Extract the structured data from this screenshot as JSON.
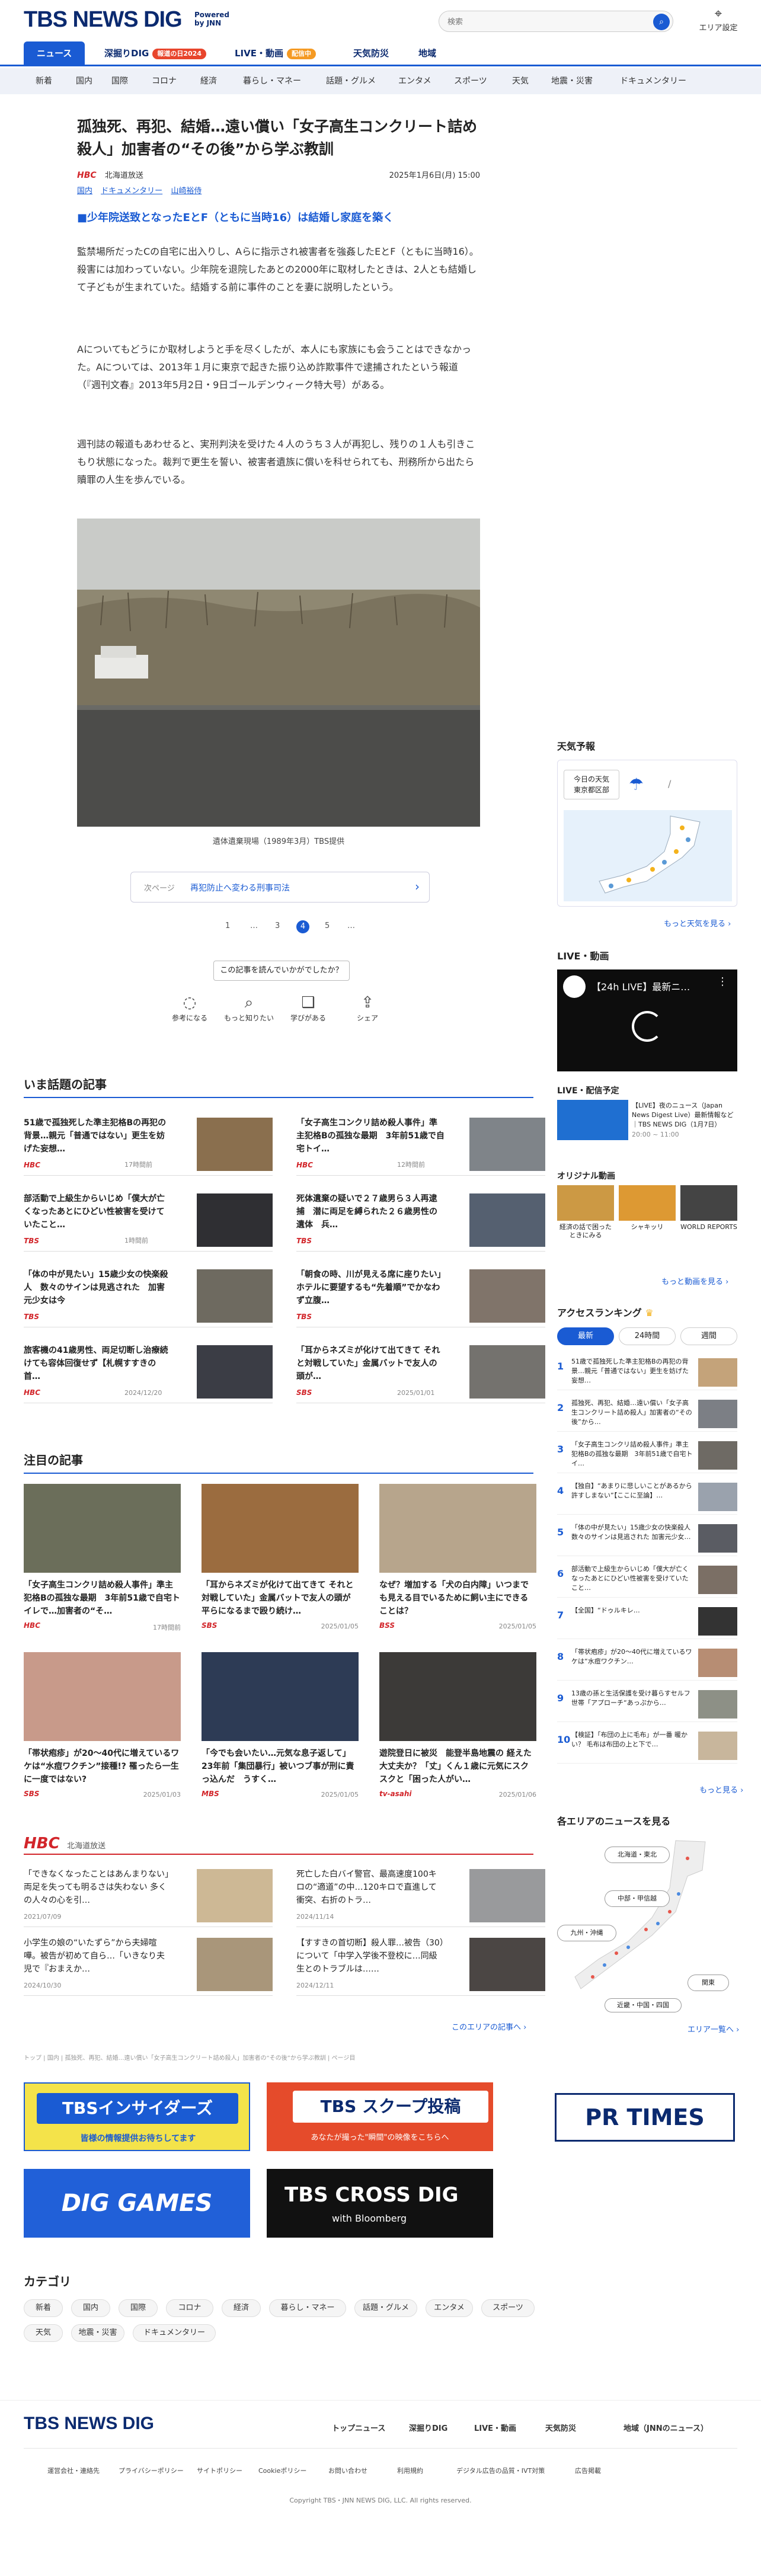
{
  "header": {
    "logo": "TBS NEWS DIG",
    "powered": "Powered by JNN",
    "search_placeholder": "検索",
    "area_label": "エリア設定"
  },
  "mainnav": [
    {
      "label": "ニュース"
    },
    {
      "label": "深掘りDIG",
      "badge": "報道の日2024"
    },
    {
      "label": "LIVE・動画",
      "badge": "配信中"
    },
    {
      "label": "天気防災"
    },
    {
      "label": "地域"
    }
  ],
  "subnav": [
    "新着",
    "国内",
    "国際",
    "コロナ",
    "経済",
    "暮らし・マネー",
    "話題・グルメ",
    "エンタメ",
    "スポーツ",
    "天気",
    "地震・災害",
    "ドキュメンタリー"
  ],
  "article": {
    "title": "孤独死、再犯、結婚…遠い償い「女子高生コンクリート詰め殺人」加害者の“その後”から学ぶ教訓",
    "source_logo": "HBC",
    "source": "北海道放送",
    "date": "2025年1月6日(月) 15:00",
    "tags": [
      "国内",
      "ドキュメンタリー",
      "山崎裕侍"
    ],
    "heading": "■少年院送致となったEとF（ともに当時16）は結婚し家庭を築く",
    "p1": "監禁場所だったCの自宅に出入りし、Aらに指示され被害者を強姦したEとF（ともに当時16）。殺害には加わっていない。少年院を退院したあとの2000年に取材したときは、2人とも結婚して子どもが生まれていた。結婚する前に事件のことを妻に説明したという。",
    "p2": "Aについてもどうにか取材しようと手を尽くしたが、本人にも家族にも会うことはできなかった。Aについては、2013年１月に東京で起きた振り込め詐欺事件で逮捕されたという報道（『週刊文春』2013年5月2日・9日ゴールデンウィーク特大号）がある。",
    "p3": "週刊誌の報道もあわせると、実刑判決を受けた４人のうち３人が再犯し、残りの１人も引きこもり状態になった。裁判で更生を誓い、被害者遺族に償いを科せられても、刑務所から出たら贖罪の人生を歩んでいる。",
    "caption": "遺体遺棄現場（1989年3月）TBS提供",
    "next_label": "次ページ",
    "next_link": "再犯防止へ変わる刑事司法",
    "pager": [
      "1",
      "…",
      "3",
      "4",
      "5",
      "…"
    ],
    "feedback": "この記事を読んでいかがでしたか？",
    "fb_items": [
      {
        "icon": "bulb-icon",
        "glyph": "💡",
        "label": "参考になる"
      },
      {
        "icon": "search-icon",
        "glyph": "🔍",
        "label": "もっと知りたい"
      },
      {
        "icon": "book-icon",
        "glyph": "📖",
        "label": "学びがある"
      },
      {
        "icon": "share-icon",
        "glyph": "⇪",
        "label": "シェア"
      }
    ]
  },
  "trending": {
    "title": "いま話題の記事",
    "items": [
      {
        "title": "51歳で孤独死した準主犯格Bの再犯の背景…親元「普通ではない」更生を妨げた妄想…",
        "source": "HBC",
        "date": "17時間前"
      },
      {
        "title": "「女子高生コンクリ詰め殺人事件」準主犯格Bの孤独な最期　3年前51歳で自宅トイ…",
        "source": "HBC",
        "date": "12時間前"
      },
      {
        "title": "部活動で上級生からいじめ「僕大が亡くなったあとにひどい性被害を受けていたこと…",
        "source": "TBS",
        "date": "1時間前"
      },
      {
        "title": "死体遺棄の疑いで２７歳男ら３人再逮捕　潜に両足を縛られた２６歳男性の遺体　兵…",
        "source": "TBS",
        "date": ""
      },
      {
        "title": "「体の中が見たい」15歳少女の快楽殺人　数々のサインは見逃された　加害元少女は今",
        "source": "TBS",
        "date": ""
      },
      {
        "title": "「朝食の時、川が見える席に座りたい」ホテルに要望するも“先着順”でかなわず立腹…",
        "source": "TBS",
        "date": ""
      },
      {
        "title": "旅客機の41歳男性、両足切断し治療続けても容体回復せず【札幌すすきの首…",
        "source": "HBC",
        "date": "2024/12/20"
      },
      {
        "title": "「耳からネズミが化けて出てきて それと対戦していた」金属バットで友人の頭が…",
        "source": "SBS",
        "date": "2025/01/01"
      }
    ]
  },
  "featured": {
    "title": "注目の記事",
    "items": [
      {
        "title": "「女子高生コンクリ詰め殺人事件」準主犯格Bの孤独な最期　3年前51歳で自宅トイレで…加害者の“そ…",
        "source": "HBC",
        "date": "17時間前"
      },
      {
        "title": "「耳からネズミが化けて出てきて それと対戦していた」金属バットで友人の頭が平らになるまで殴り続け…",
        "source": "SBS",
        "date": "2025/01/05"
      },
      {
        "title": "なぜ？増加する「犬の白内障」いつまでも見える目でいるために飼い主にできることは？",
        "source": "BSS",
        "date": "2025/01/05"
      },
      {
        "title": "「帯状疱疹」が20～40代に増えているワケは“水痘ワクチン”接種!? 罹ったら一生に一度ではない?",
        "source": "SBS",
        "date": "2025/01/03"
      },
      {
        "title": "「今でも会いたい…元気な息子返して」23年前「集団暴行」被いつブ事が刑に責っ込んだ　うすく…",
        "source": "MBS",
        "date": "2025/01/05"
      },
      {
        "title": "遊院登日に被災　能登半島地震の 経えた大丈夫か？「丈」くん１歳に元気にスクスクと「困った人がい…",
        "source": "tv-asahi",
        "date": "2025/01/06"
      }
    ]
  },
  "regional": {
    "station": "HBC",
    "region": "北海道放送",
    "items": [
      {
        "title": "「できなくなったことはあんまりない」両足を失っても明るさは失わない 多くの人々の心を引…",
        "date": "2021/07/09"
      },
      {
        "title": "死亡した白バイ警官、最高速度100キロの“適道”の中…120キロで直進して衝突、右折のトラ…",
        "date": "2024/11/14"
      },
      {
        "title": "小学生の娘の“いたずら”から夫婦喧嘩。被告が初めて自ら…「いきなり夫児で『おまえか…",
        "date": "2024/10/30"
      },
      {
        "title": "【すすきの首切断】殺人罪…被告（30）について「中学入学後不登校に…同級生とのトラブルは……",
        "date": "2024/12/11"
      }
    ],
    "more": "このエリアの記事へ"
  },
  "breadcrumb": "トップ | 国内 | 孤独死、再犯、結婚…遠い償い「女子高生コンクリート詰め殺人」加害者の“その後”から学ぶ教訓 | ページ目",
  "banners": [
    {
      "label": "TBSインサイダーズ",
      "sub": "皆様の情報提供お待ちしてます"
    },
    {
      "label": "TBS スクープ投稿",
      "sub": "あなたが撮った\"瞬間\"の映像をこちらへ"
    },
    {
      "label": "PR TIMES"
    },
    {
      "label": "DIG GAMES"
    },
    {
      "label": "TBS CROSS DIG",
      "sub": "with Bloomberg"
    }
  ],
  "categories": {
    "title": "カテゴリ",
    "items": [
      "新着",
      "国内",
      "国際",
      "コロナ",
      "経済",
      "暮らし・マネー",
      "話題・グルメ",
      "エンタメ",
      "スポーツ",
      "天気",
      "地震・災害",
      "ドキュメンタリー"
    ]
  },
  "sidebar": {
    "weather": {
      "title": "天気予報",
      "today": "今日の天気",
      "place": "東京都区部",
      "more": "もっと天気を見る"
    },
    "live": {
      "title": "LIVE・動画",
      "video_title": "【24h LIVE】最新ニ…",
      "schedule": "LIVE・配信予定",
      "sched_time": "20:00 ~ 11:00",
      "sched_desc": "【LIVE】夜のニュース（Japan News Digest Live）最新情報など｜TBS NEWS DIG（1月7日）",
      "orig": "オリジナル動画",
      "orig_items": [
        "経済の話で困ったときにみる",
        "シャキッリ",
        "WORLD REPORTS"
      ],
      "more": "もっと動画を見る"
    },
    "ranking": {
      "title": "アクセスランキング",
      "tabs": [
        "最新",
        "24時間",
        "週間"
      ],
      "items": [
        "51歳で孤独死した準主犯格Bの再犯の背景…親元「普通ではない」更生を妨げた妄想…",
        "孤独死、再犯、結婚…遠い償い「女子高生コンクリート詰め殺人」加害者の“その後”から…",
        "「女子高生コンクリ詰め殺人事件」準主犯格Bの孤独な最期　3年前51歳で自宅トイ…",
        "【独自】“あまりに悲しいことがあるから許すしまない”【ここに至論】…",
        "「体の中が見たい」15歳少女の快楽殺人　数々のサインは見逃された 加害元少女…",
        "部活動で上級生からいじめ「僕大が亡くなったあとにひどい性被害を受けていたこと…",
        "【全国】“ドゥルキレ…",
        "「帯状疱疹」が20～40代に増えているワケは“水痘ワクチン…",
        "13歳の孫と生活保護を受け暮らすセルフ世帯「アプローチ“あっぷから…",
        "【検証】「布団の上に毛布」が一番 暖かい？ 毛布は布団の上と下で…"
      ],
      "more": "もっと見る"
    },
    "regions": {
      "title": "各エリアのニュースを見る",
      "items": [
        "北海道・東北",
        "中部・甲信越",
        "九州・沖縄",
        "関東",
        "近畿・中国・四国"
      ],
      "more": "エリア一覧へ"
    }
  },
  "footer": {
    "logo": "TBS NEWS DIG",
    "nav": [
      "トップニュース",
      "深掘りDIG",
      "LIVE・動画",
      "天気防災",
      "地域（JNNのニュース）"
    ],
    "links": [
      "運営会社・連絡先",
      "プライバシーポリシー",
      "サイトポリシー",
      "Cookieポリシー",
      "お問い合わせ",
      "利用規約",
      "デジタル広告の品質・IVT対策",
      "広告掲載"
    ],
    "copyright": "Copyright TBS・JNN NEWS DIG, LLC. All rights reserved."
  }
}
